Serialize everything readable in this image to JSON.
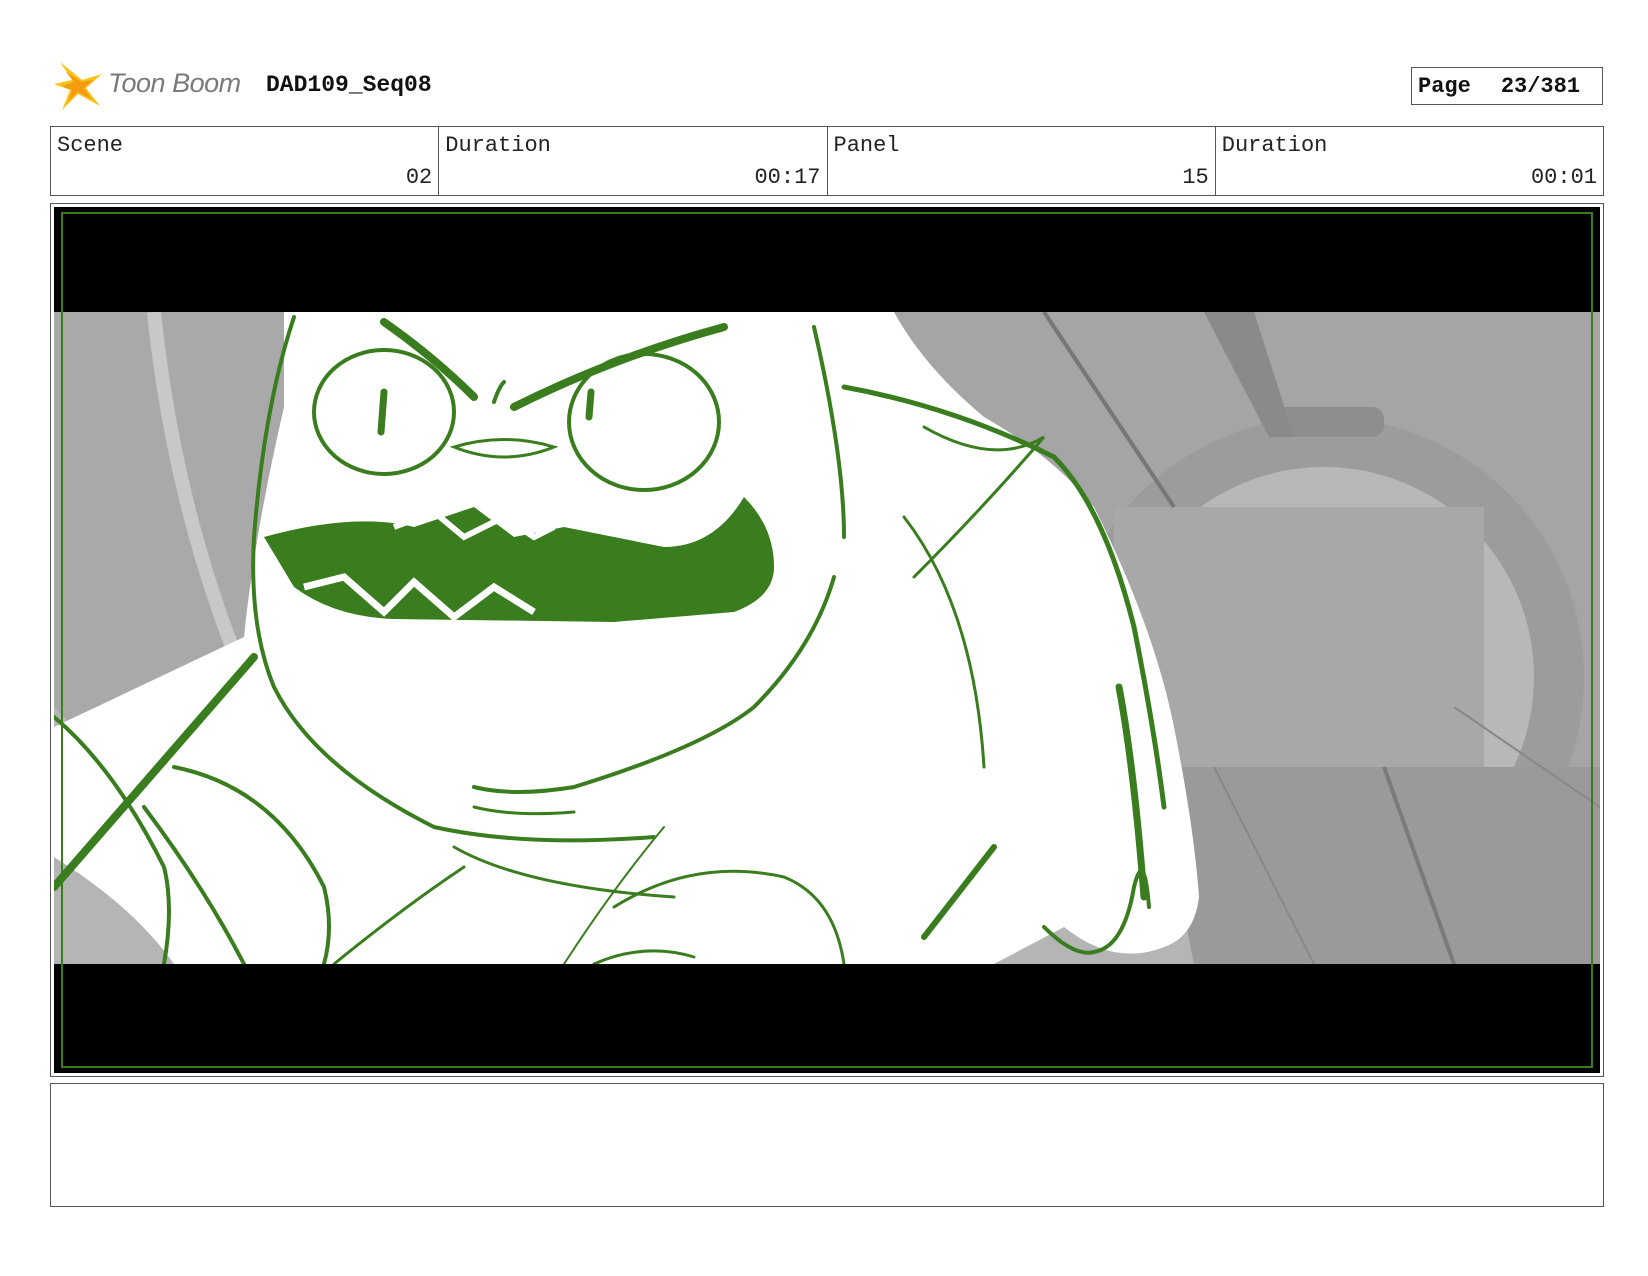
{
  "header": {
    "logo_text": "Toon Boom",
    "sequence_title": "DAD109_Seq08",
    "page_label": "Page",
    "page_number": "23/381"
  },
  "info": {
    "scene_label": "Scene",
    "scene_value": "02",
    "scene_duration_label": "Duration",
    "scene_duration_value": "00:17",
    "panel_label": "Panel",
    "panel_value": "15",
    "panel_duration_label": "Duration",
    "panel_duration_value": "00:01"
  },
  "notes": {
    "text": ""
  },
  "colors": {
    "line_green": "#3a7d1e",
    "letterbox": "#000000",
    "background_gray": "#9a9a9a"
  }
}
